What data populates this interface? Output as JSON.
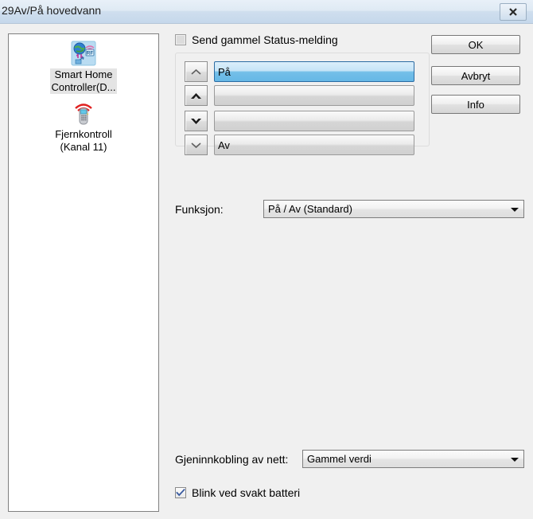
{
  "window": {
    "title": "29Av/På hovedvann",
    "close_icon": "close-icon"
  },
  "device_panel": {
    "items": [
      {
        "label": "Smart Home\nController(D...",
        "icon": "globe-rf-icon",
        "selected": true
      },
      {
        "label": "Fjernkontroll\n(Kanal 11)",
        "icon": "remote-control-icon",
        "selected": false
      }
    ]
  },
  "main": {
    "status_checkbox": {
      "label": "Send gammel Status-melding",
      "checked": false
    },
    "level_rows": [
      {
        "arrow": "chevron-up-thin-icon",
        "value": "På",
        "selected": true
      },
      {
        "arrow": "arrow-up-bold-icon",
        "value": "",
        "selected": false
      },
      {
        "arrow": "arrow-down-bold-icon",
        "value": "",
        "selected": false
      },
      {
        "arrow": "chevron-down-thin-icon",
        "value": "Av",
        "selected": false
      }
    ],
    "funksjon": {
      "label": "Funksjon:",
      "value": "På / Av (Standard)"
    },
    "gjeninnkobling": {
      "label": "Gjeninnkobling av nett:",
      "value": "Gammel verdi"
    },
    "battery_checkbox": {
      "label": "Blink ved svakt batteri",
      "checked": true
    }
  },
  "buttons": {
    "ok": "OK",
    "cancel": "Avbryt",
    "info": "Info"
  },
  "colors": {
    "selection_blue": "#66b8e6",
    "selection_border": "#2c6ca3",
    "titlebar": "#c5d8eb",
    "dialog_bg": "#f0f0f0",
    "check_blue": "#3a5ba0"
  }
}
